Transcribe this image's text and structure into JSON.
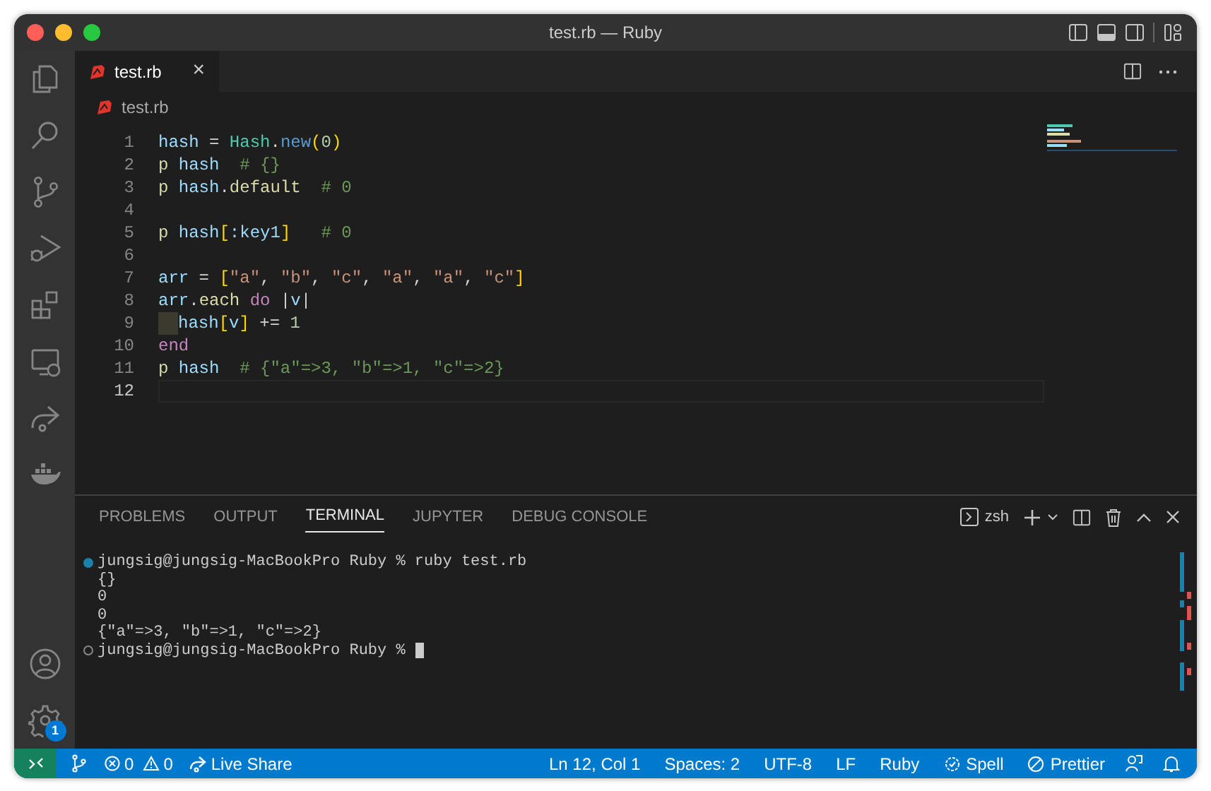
{
  "window": {
    "title": "test.rb — Ruby"
  },
  "activity_bar": {
    "settings_badge": "1"
  },
  "editor_tabs": [
    {
      "label": "test.rb",
      "selected": true,
      "close": "×"
    }
  ],
  "breadcrumb": "test.rb",
  "code_lines": [
    {
      "number": "1",
      "current": false,
      "tokens": [
        {
          "text": "hash",
          "kind": "var"
        },
        {
          "text": " = ",
          "kind": "op"
        },
        {
          "text": "Hash",
          "kind": "const"
        },
        {
          "text": ".",
          "kind": "op"
        },
        {
          "text": "new",
          "kind": "method"
        },
        {
          "text": "(",
          "kind": "bracket"
        },
        {
          "text": "0",
          "kind": "number"
        },
        {
          "text": ")",
          "kind": "bracket"
        }
      ]
    },
    {
      "number": "2",
      "current": false,
      "tokens": [
        {
          "text": "p ",
          "kind": "func"
        },
        {
          "text": "hash",
          "kind": "var"
        },
        {
          "text": "  # {}",
          "kind": "comment"
        }
      ]
    },
    {
      "number": "3",
      "current": false,
      "tokens": [
        {
          "text": "p ",
          "kind": "func"
        },
        {
          "text": "hash",
          "kind": "var"
        },
        {
          "text": ".",
          "kind": "op"
        },
        {
          "text": "default",
          "kind": "func"
        },
        {
          "text": "  # 0",
          "kind": "comment"
        }
      ]
    },
    {
      "number": "4",
      "current": false
    },
    {
      "number": "5",
      "current": false,
      "tokens": [
        {
          "text": "p ",
          "kind": "func"
        },
        {
          "text": "hash",
          "kind": "var"
        },
        {
          "text": "[",
          "kind": "bracket"
        },
        {
          "text": ":key1",
          "kind": "var"
        },
        {
          "text": "]",
          "kind": "bracket"
        },
        {
          "text": "   # 0",
          "kind": "comment"
        }
      ]
    },
    {
      "number": "6",
      "current": false
    },
    {
      "number": "7",
      "current": false,
      "tokens": [
        {
          "text": "arr",
          "kind": "var"
        },
        {
          "text": " = ",
          "kind": "op"
        },
        {
          "text": "[",
          "kind": "bracket"
        },
        {
          "text": "\"a\"",
          "kind": "string"
        },
        {
          "text": ", ",
          "kind": "op"
        },
        {
          "text": "\"b\"",
          "kind": "string"
        },
        {
          "text": ", ",
          "kind": "op"
        },
        {
          "text": "\"c\"",
          "kind": "string"
        },
        {
          "text": ", ",
          "kind": "op"
        },
        {
          "text": "\"a\"",
          "kind": "string"
        },
        {
          "text": ", ",
          "kind": "op"
        },
        {
          "text": "\"a\"",
          "kind": "string"
        },
        {
          "text": ", ",
          "kind": "op"
        },
        {
          "text": "\"c\"",
          "kind": "string"
        },
        {
          "text": "]",
          "kind": "bracket"
        }
      ]
    },
    {
      "number": "8",
      "current": false,
      "tokens": [
        {
          "text": "arr",
          "kind": "var"
        },
        {
          "text": ".",
          "kind": "op"
        },
        {
          "text": "each",
          "kind": "func"
        },
        {
          "text": " do",
          "kind": "keyword"
        },
        {
          "text": " |",
          "kind": "op"
        },
        {
          "text": "v",
          "kind": "var"
        },
        {
          "text": "|",
          "kind": "op"
        }
      ]
    },
    {
      "number": "9",
      "current": false,
      "indent_guide": true,
      "tokens": [
        {
          "text": "hash",
          "kind": "var"
        },
        {
          "text": "[",
          "kind": "bracket"
        },
        {
          "text": "v",
          "kind": "var"
        },
        {
          "text": "]",
          "kind": "bracket"
        },
        {
          "text": " += ",
          "kind": "op"
        },
        {
          "text": "1",
          "kind": "number"
        }
      ]
    },
    {
      "number": "10",
      "current": false,
      "tokens": [
        {
          "text": "end",
          "kind": "keyword"
        }
      ]
    },
    {
      "number": "11",
      "current": false,
      "tokens": [
        {
          "text": "p ",
          "kind": "func"
        },
        {
          "text": "hash",
          "kind": "var"
        },
        {
          "text": "  # {\"a\"=>3, \"b\"=>1, \"c\"=>2}",
          "kind": "comment"
        }
      ]
    },
    {
      "number": "12",
      "current": true
    }
  ],
  "panel_tabs": [
    {
      "label": "PROBLEMS",
      "selected": false
    },
    {
      "label": "OUTPUT",
      "selected": false
    },
    {
      "label": "TERMINAL",
      "selected": true
    },
    {
      "label": "JUPYTER",
      "selected": false
    },
    {
      "label": "DEBUG CONSOLE",
      "selected": false
    }
  ],
  "terminal": {
    "shell": "zsh",
    "lines": [
      {
        "kind": "command",
        "text": "jungsig@jungsig-MacBookPro Ruby % ruby test.rb"
      },
      {
        "kind": "output",
        "text": "{}"
      },
      {
        "kind": "output",
        "text": "0"
      },
      {
        "kind": "output",
        "text": "0"
      },
      {
        "kind": "output",
        "text": "{\"a\"=>3, \"b\"=>1, \"c\"=>2}"
      },
      {
        "kind": "prompt",
        "text": "jungsig@jungsig-MacBookPro Ruby %"
      }
    ]
  },
  "status_bar": {
    "errors": "0",
    "warnings": "0",
    "live_share": "Live Share",
    "right": [
      {
        "kind": "text",
        "text": "Ln 12, Col 1"
      },
      {
        "kind": "text",
        "text": "Spaces: 2"
      },
      {
        "kind": "text",
        "text": "UTF-8"
      },
      {
        "kind": "text",
        "text": "LF"
      },
      {
        "kind": "text",
        "text": "Ruby"
      },
      {
        "kind": "spell",
        "text": "Spell"
      },
      {
        "kind": "prettier",
        "text": "Prettier"
      }
    ]
  }
}
